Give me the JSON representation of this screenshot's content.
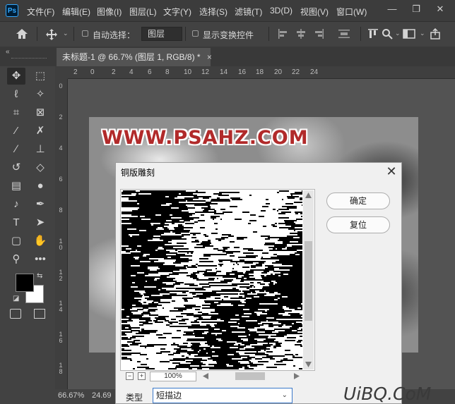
{
  "menubar": {
    "logo": "Ps",
    "items": [
      "文件(F)",
      "编辑(E)",
      "图像(I)",
      "图层(L)",
      "文字(Y)",
      "选择(S)",
      "滤镜(T)",
      "3D(D)",
      "视图(V)",
      "窗口(W)"
    ],
    "window_controls": [
      "—",
      "❐",
      "✕"
    ]
  },
  "options": {
    "auto_select_label": "自动选择：",
    "layer_select_value": "图层",
    "show_transform_label": "显示变换控件"
  },
  "tab": {
    "title": "未标题-1 @ 66.7% (图层 1, RGB/8) *",
    "close": "×"
  },
  "ruler": {
    "top_ticks": [
      "2",
      "0",
      "2",
      "4",
      "6",
      "8",
      "10",
      "12",
      "14",
      "16",
      "18",
      "20",
      "22",
      "24"
    ],
    "left_ticks": [
      "0",
      "2",
      "4",
      "6",
      "8",
      "1\n0",
      "1\n2",
      "1\n4",
      "1\n6",
      "1\n8"
    ]
  },
  "canvas": {
    "watermark": "WWW.PSAHZ.COM"
  },
  "status": {
    "zoom": "66.67%",
    "size": "24.69"
  },
  "dialog": {
    "title": "铜版雕刻",
    "close": "✕",
    "ok_label": "确定",
    "reset_label": "复位",
    "zoom_value": "100%",
    "type_label": "类型",
    "type_value": "短描边",
    "zoom_out": "−",
    "zoom_in": "+"
  },
  "site_logo": "UiBQ.CoM",
  "colors": {
    "watermark_red": "#b12a2a",
    "ps_blue": "#31a8ff",
    "select_border": "#3a78c9"
  }
}
